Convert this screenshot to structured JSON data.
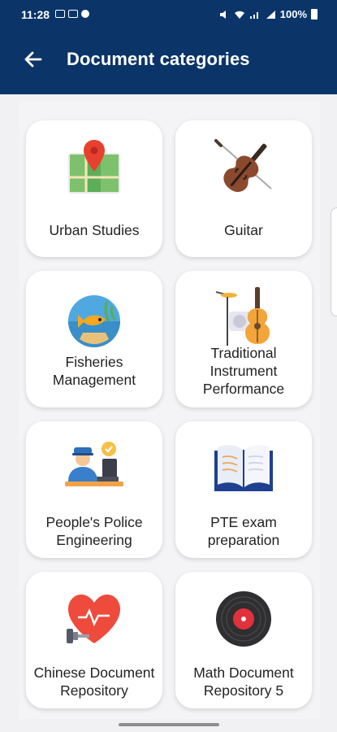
{
  "status_bar": {
    "time": "11:28",
    "battery": "100%"
  },
  "app_bar": {
    "title": "Document categories"
  },
  "categories": [
    {
      "label": "Urban Studies",
      "icon": "map-pin-icon"
    },
    {
      "label": "Guitar",
      "icon": "violin-icon"
    },
    {
      "label": "Fisheries Management",
      "icon": "fish-icon"
    },
    {
      "label": "Traditional Instrument Performance",
      "icon": "instruments-icon"
    },
    {
      "label": "People's Police Engineering",
      "icon": "police-officer-icon"
    },
    {
      "label": "PTE exam preparation",
      "icon": "open-book-icon"
    },
    {
      "label": "Chinese Document Repository",
      "icon": "heart-dumbbell-icon"
    },
    {
      "label": "Math Document Repository 5",
      "icon": "vinyl-record-icon"
    }
  ],
  "colors": {
    "header": "#0b3569",
    "card": "#ffffff",
    "background": "#f1f1f3"
  }
}
